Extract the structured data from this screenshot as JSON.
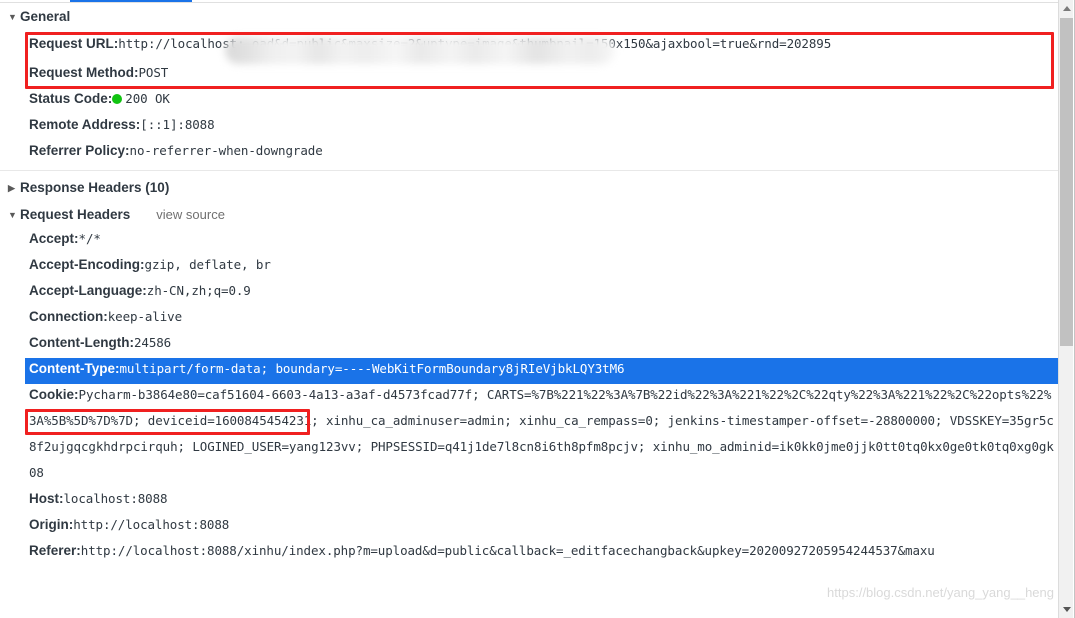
{
  "panel": {
    "selected_tab_indicator_color": "#1a73e8"
  },
  "sections": {
    "general": {
      "twisty": "▼",
      "title": "General",
      "rows": [
        {
          "name": "Request URL:",
          "value": "http://localhost:                                              oad&d=public&maxsize=2&uptype=image&thumbnail=150x150&ajaxbool=true&rnd=202895"
        },
        {
          "name": "Request Method:",
          "value": "POST"
        },
        {
          "name": "Status Code:",
          "value": "200 OK",
          "icon": "status-ok-dot",
          "icon_color": "#11c411"
        },
        {
          "name": "Remote Address:",
          "value": "[::1]:8088"
        },
        {
          "name": "Referrer Policy:",
          "value": "no-referrer-when-downgrade"
        }
      ]
    },
    "response_headers": {
      "twisty": "▶",
      "title": "Response Headers (10)"
    },
    "request_headers": {
      "twisty": "▼",
      "title": "Request Headers",
      "view_source_label": "view source",
      "rows": [
        {
          "name": "Accept:",
          "value": "*/*"
        },
        {
          "name": "Accept-Encoding:",
          "value": "gzip, deflate, br"
        },
        {
          "name": "Accept-Language:",
          "value": "zh-CN,zh;q=0.9"
        },
        {
          "name": "Connection:",
          "value": "keep-alive"
        },
        {
          "name": "Content-Length:",
          "value": "24586"
        },
        {
          "name": "Content-Type:",
          "value": "multipart/form-data; boundary=----WebKitFormBoundary8jRIeVjbkLQY3tM6",
          "selected": true
        },
        {
          "name": "Cookie:",
          "value": "Pycharm-b3864e80=caf51604-6603-4a13-a3af-d4573fcad77f; CARTS=%7B%221%22%3A%7B%22id%22%3A%221%22%2C%22qty%22%3A%221%22%2C%22opts%22%3A%5B%5D%7D%7D; deviceid=1600845454231; xinhu_ca_adminuser=admin; xinhu_ca_rempass=0; jenkins-timestamper-offset=-28800000; VDSSKEY=35gr5c8f2ujgqcgkhdrpcirquh; LOGINED_USER=yang123vv; PHPSESSID=q41j1de7l8cn8i6th8pfm8pcjv; xinhu_mo_adminid=ik0kk0jme0jjk0tt0tq0kx0ge0tk0tq0xg0gk08"
        },
        {
          "name": "Host:",
          "value": "localhost:8088"
        },
        {
          "name": "Origin:",
          "value": "http://localhost:8088"
        },
        {
          "name": "Referer:",
          "value": "http://localhost:8088/xinhu/index.php?m=upload&d=public&callback=_editfacechangback&upkey=20200927205954244537&maxu"
        }
      ]
    }
  },
  "annotations": {
    "highlight_color": "#f02020",
    "boxes": [
      {
        "id": "request-url",
        "target": "Request URL row"
      },
      {
        "id": "content-type",
        "target": "Content-Type header name and value"
      }
    ]
  },
  "scrollbar": {
    "up_arrow": "▲",
    "down_arrow": "▼"
  },
  "watermark": {
    "text": "https://blog.csdn.net/yang_yang__heng"
  }
}
